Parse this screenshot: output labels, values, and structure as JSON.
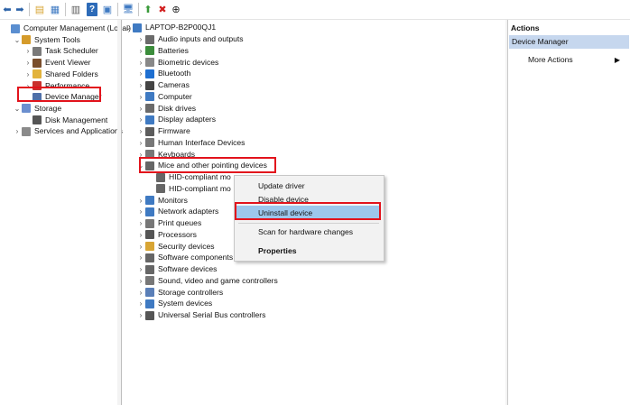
{
  "toolbar": {
    "buttons": [
      {
        "name": "back-arrow-icon",
        "glyph": "⬅",
        "color": "#2a61a7"
      },
      {
        "name": "forward-arrow-icon",
        "glyph": "➡",
        "color": "#2a61a7"
      },
      {
        "name": "up-folder-icon",
        "glyph": "▤",
        "color": "#d8a534"
      },
      {
        "name": "show-hide-tree-icon",
        "glyph": "▦",
        "color": "#3f7ac2"
      },
      {
        "name": "export-list-icon",
        "glyph": "▥",
        "color": "#5c5c5c"
      },
      {
        "name": "help-icon",
        "glyph": "?",
        "color": "#ffffff"
      },
      {
        "name": "properties-icon",
        "glyph": "▣",
        "color": "#3f7ac2"
      },
      {
        "name": "computer-icon",
        "glyph": "🖥",
        "color": "#3f7ac2"
      },
      {
        "name": "update-driver-icon",
        "glyph": "⬆",
        "color": "#3a9a3a"
      },
      {
        "name": "uninstall-x-icon",
        "glyph": "✖",
        "color": "#d21f1f"
      },
      {
        "name": "download-icon",
        "glyph": "⊕",
        "color": "#222222"
      }
    ]
  },
  "left_tree": [
    {
      "label": "Computer Management (Local)",
      "exp": "",
      "icon": "#5a8ed0",
      "name": "tree-item-computer-management"
    },
    {
      "label": "System Tools",
      "exp": "⌄",
      "icon": "#d59b2a",
      "name": "tree-item-system-tools"
    },
    {
      "label": "Task Scheduler",
      "exp": "›",
      "icon": "#7a7a7a",
      "name": "tree-item-task-scheduler"
    },
    {
      "label": "Event Viewer",
      "exp": "›",
      "icon": "#7a4e2c",
      "name": "tree-item-event-viewer"
    },
    {
      "label": "Shared Folders",
      "exp": "›",
      "icon": "#e2b33c",
      "name": "tree-item-shared-folders"
    },
    {
      "label": "Performance",
      "exp": "›",
      "icon": "#c9302c",
      "name": "tree-item-performance"
    },
    {
      "label": "Device Manager",
      "exp": "",
      "icon": "#4f6fa8",
      "name": "tree-item-device-manager"
    },
    {
      "label": "Storage",
      "exp": "⌄",
      "icon": "#6b8fcf",
      "name": "tree-item-storage"
    },
    {
      "label": "Disk Management",
      "exp": "",
      "icon": "#555555",
      "name": "tree-item-disk-management"
    },
    {
      "label": "Services and Applications",
      "exp": "›",
      "icon": "#8a8a8a",
      "name": "tree-item-services-applications"
    }
  ],
  "device_tree": {
    "root": "LAPTOP-B2P00QJ1",
    "categories": [
      {
        "label": "Audio inputs and outputs",
        "icon": "#6b6b6b"
      },
      {
        "label": "Batteries",
        "icon": "#3c8d3c"
      },
      {
        "label": "Biometric devices",
        "icon": "#888888"
      },
      {
        "label": "Bluetooth",
        "icon": "#1e6fd1"
      },
      {
        "label": "Cameras",
        "icon": "#444444"
      },
      {
        "label": "Computer",
        "icon": "#3f7ac2"
      },
      {
        "label": "Disk drives",
        "icon": "#6b6b6b"
      },
      {
        "label": "Display adapters",
        "icon": "#3f7ac2"
      },
      {
        "label": "Firmware",
        "icon": "#5c5c5c"
      },
      {
        "label": "Human Interface Devices",
        "icon": "#777777"
      },
      {
        "label": "Keyboards",
        "icon": "#777777"
      },
      {
        "label": "Mice and other pointing devices",
        "icon": "#666666"
      },
      {
        "label": "HID-compliant mo",
        "icon": "#666666"
      },
      {
        "label": "HID-compliant mo",
        "icon": "#666666"
      },
      {
        "label": "Monitors",
        "icon": "#3f7ac2"
      },
      {
        "label": "Network adapters",
        "icon": "#3f7ac2"
      },
      {
        "label": "Print queues",
        "icon": "#777777"
      },
      {
        "label": "Processors",
        "icon": "#555555"
      },
      {
        "label": "Security devices",
        "icon": "#d8a534"
      },
      {
        "label": "Software components",
        "icon": "#666666"
      },
      {
        "label": "Software devices",
        "icon": "#666666"
      },
      {
        "label": "Sound, video and game controllers",
        "icon": "#777777"
      },
      {
        "label": "Storage controllers",
        "icon": "#5a7fb8"
      },
      {
        "label": "System devices",
        "icon": "#3f7ac2"
      },
      {
        "label": "Universal Serial Bus controllers",
        "icon": "#555555"
      }
    ]
  },
  "context_menu": {
    "items": [
      "Update driver",
      "Disable device",
      "Uninstall device",
      "Scan for hardware changes",
      "Properties"
    ]
  },
  "actions": {
    "header": "Actions",
    "selected": "Device Manager",
    "more": "More Actions"
  },
  "colors": {
    "highlight": "#e2131c",
    "selection": "#c6d7ee",
    "menu_selection": "#9dc7ec"
  }
}
